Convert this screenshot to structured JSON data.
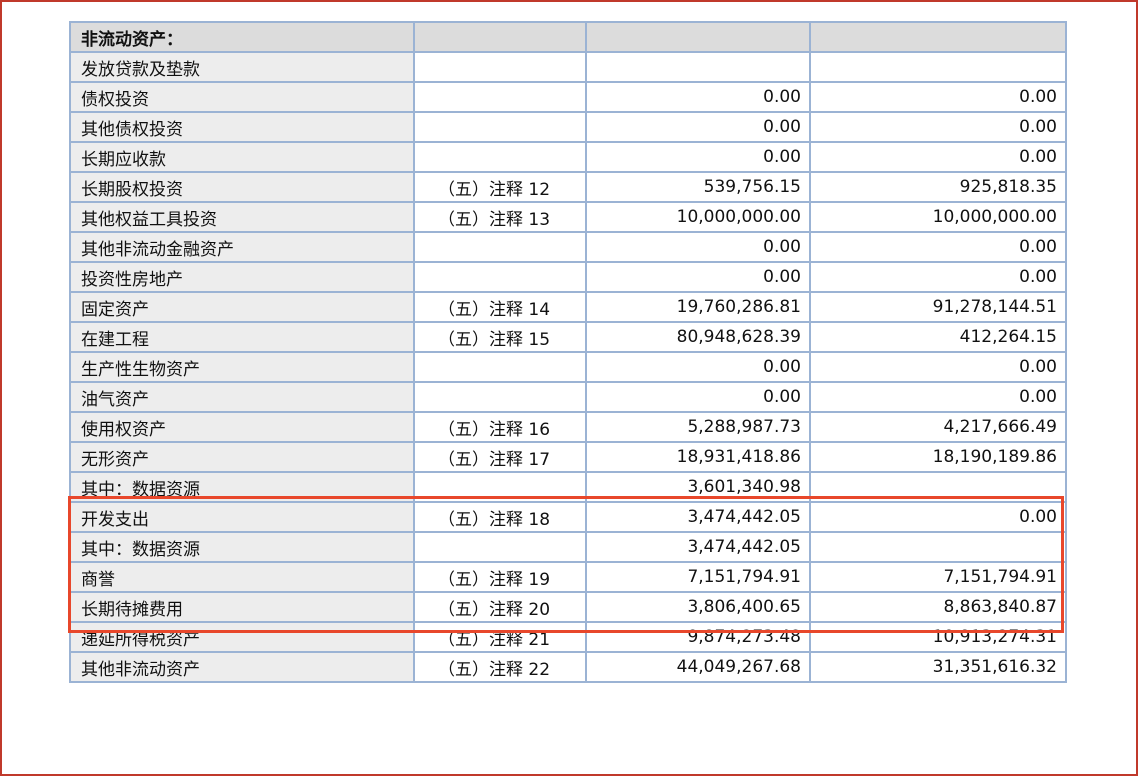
{
  "table": {
    "header": {
      "label": "非流动资产：",
      "note": "",
      "current": "",
      "previous": ""
    },
    "rows": [
      {
        "label": "发放贷款及垫款",
        "note": "",
        "current": "",
        "previous": ""
      },
      {
        "label": "债权投资",
        "note": "",
        "current": "0.00",
        "previous": "0.00"
      },
      {
        "label": "其他债权投资",
        "note": "",
        "current": "0.00",
        "previous": "0.00"
      },
      {
        "label": "长期应收款",
        "note": "",
        "current": "0.00",
        "previous": "0.00"
      },
      {
        "label": "长期股权投资",
        "note": "（五）注释 12",
        "current": "539,756.15",
        "previous": "925,818.35"
      },
      {
        "label": "其他权益工具投资",
        "note": "（五）注释 13",
        "current": "10,000,000.00",
        "previous": "10,000,000.00"
      },
      {
        "label": "其他非流动金融资产",
        "note": "",
        "current": "0.00",
        "previous": "0.00"
      },
      {
        "label": "投资性房地产",
        "note": "",
        "current": "0.00",
        "previous": "0.00"
      },
      {
        "label": "固定资产",
        "note": "（五）注释 14",
        "current": "19,760,286.81",
        "previous": "91,278,144.51"
      },
      {
        "label": "在建工程",
        "note": "（五）注释 15",
        "current": "80,948,628.39",
        "previous": "412,264.15"
      },
      {
        "label": "生产性生物资产",
        "note": "",
        "current": "0.00",
        "previous": "0.00"
      },
      {
        "label": "油气资产",
        "note": "",
        "current": "0.00",
        "previous": "0.00"
      },
      {
        "label": "使用权资产",
        "note": "（五）注释 16",
        "current": "5,288,987.73",
        "previous": "4,217,666.49"
      },
      {
        "label": "无形资产",
        "note": "（五）注释 17",
        "current": "18,931,418.86",
        "previous": "18,190,189.86"
      },
      {
        "label": "其中：数据资源",
        "note": "",
        "current": "3,601,340.98",
        "previous": ""
      },
      {
        "label": "开发支出",
        "note": "（五）注释 18",
        "current": "3,474,442.05",
        "previous": "0.00"
      },
      {
        "label": "其中：数据资源",
        "note": "",
        "current": "3,474,442.05",
        "previous": ""
      },
      {
        "label": "商誉",
        "note": "（五）注释 19",
        "current": "7,151,794.91",
        "previous": "7,151,794.91"
      },
      {
        "label": "长期待摊费用",
        "note": "（五）注释 20",
        "current": "3,806,400.65",
        "previous": "8,863,840.87"
      },
      {
        "label": "递延所得税资产",
        "note": "（五）注释 21",
        "current": "9,874,273.48",
        "previous": "10,913,274.31"
      },
      {
        "label": "其他非流动资产",
        "note": "（五）注释 22",
        "current": "44,049,267.68",
        "previous": "31,351,616.32"
      }
    ]
  },
  "colors": {
    "highlight": "#e8472b",
    "grid": "#9bb3d4",
    "frame": "#c0392b"
  }
}
